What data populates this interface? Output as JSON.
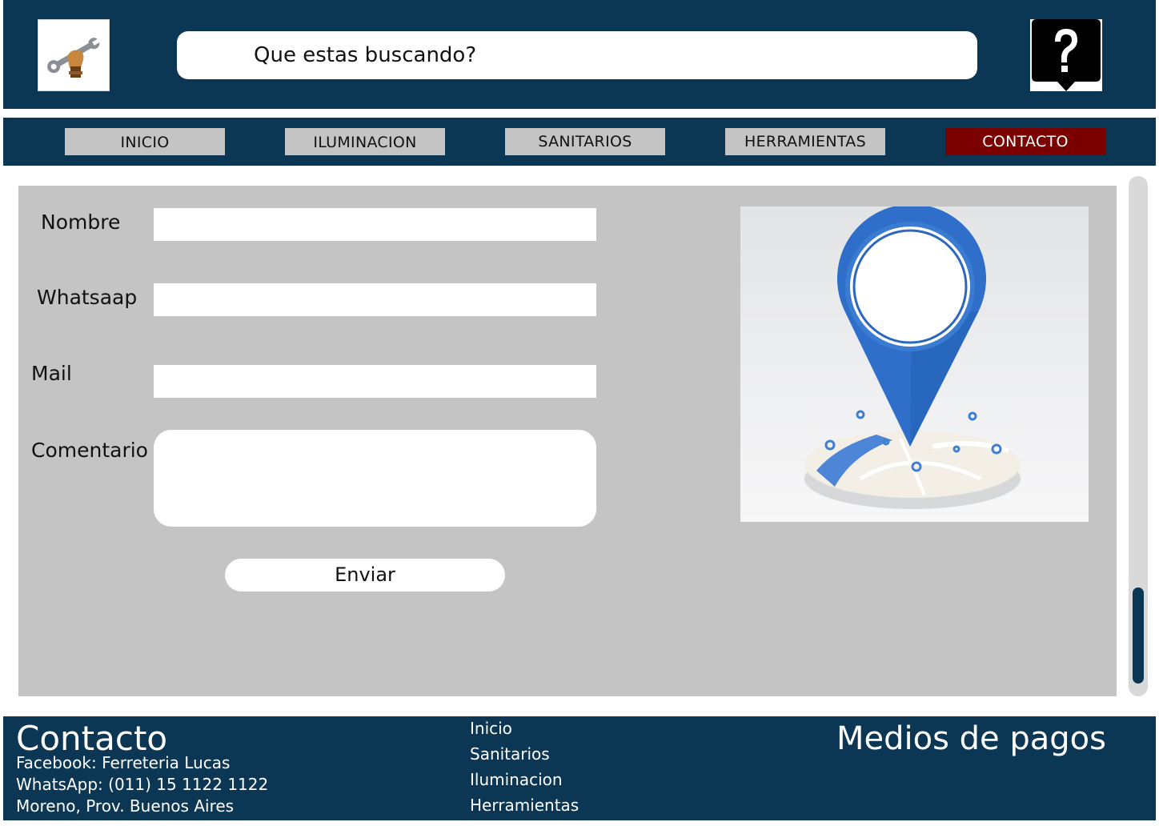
{
  "header": {
    "search_placeholder": "Que estas buscando?",
    "logo_icon": "hand-wrench-icon",
    "help_icon": "question-mark-icon"
  },
  "nav": {
    "items": [
      {
        "label": "INICIO"
      },
      {
        "label": "ILUMINACION"
      },
      {
        "label": "SANITARIOS"
      },
      {
        "label": "HERRAMIENTAS"
      },
      {
        "label": "CONTACTO",
        "active": true
      }
    ],
    "active_color": "#7b0000"
  },
  "form": {
    "nombre_label": "Nombre",
    "nombre_value": "",
    "whatsapp_label": "Whatsaap",
    "whatsapp_value": "",
    "mail_label": "Mail",
    "mail_value": "",
    "comentario_label": "Comentario",
    "comentario_value": "",
    "submit_label": "Enviar"
  },
  "map": {
    "icon": "location-pin-icon"
  },
  "footer": {
    "contact_title": "Contacto",
    "contact_lines": [
      "Facebook: Ferreteria Lucas",
      "WhatsApp: (011) 15 1122 1122",
      "Moreno, Prov. Buenos Aires"
    ],
    "links": [
      "Inicio",
      "Sanitarios",
      "Iluminacion",
      "Herramientas"
    ],
    "payments_title": "Medios de pagos"
  },
  "colors": {
    "brand_navy": "#0b3754",
    "panel_gray": "#c4c4c4"
  }
}
